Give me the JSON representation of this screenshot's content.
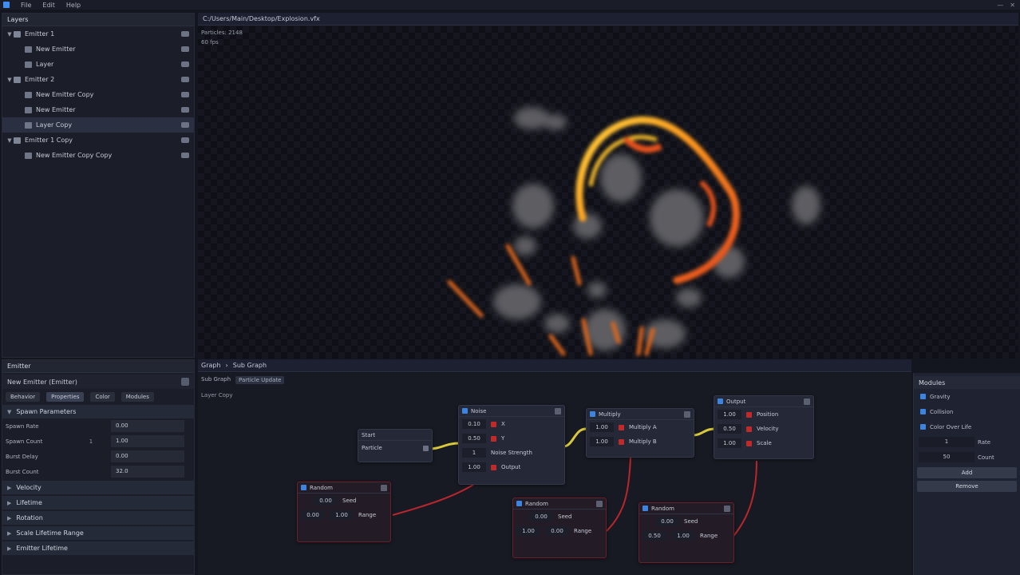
{
  "menu": {
    "items": [
      "File",
      "Edit",
      "Help"
    ]
  },
  "tree": {
    "title": "Layers",
    "rows": [
      {
        "label": "Emitter 1",
        "indent": 0,
        "expanded": true,
        "selected": false
      },
      {
        "label": "New Emitter",
        "indent": 1,
        "expanded": false,
        "selected": false
      },
      {
        "label": "Layer",
        "indent": 1,
        "expanded": false,
        "selected": false
      },
      {
        "label": "Emitter 2",
        "indent": 0,
        "expanded": true,
        "selected": false
      },
      {
        "label": "New Emitter Copy",
        "indent": 1,
        "expanded": false,
        "selected": false
      },
      {
        "label": "New Emitter",
        "indent": 1,
        "expanded": false,
        "selected": false
      },
      {
        "label": "Layer Copy",
        "indent": 1,
        "expanded": false,
        "selected": true
      },
      {
        "label": "Emitter 1 Copy",
        "indent": 0,
        "expanded": true,
        "selected": false
      },
      {
        "label": "New Emitter Copy Copy",
        "indent": 1,
        "expanded": false,
        "selected": false
      }
    ]
  },
  "viewport": {
    "tab": "C:/Users/Main/Desktop/Explosion.vfx",
    "status_line": "Particles: 2148",
    "fps": "60 fps"
  },
  "props": {
    "title": "Emitter",
    "emitter_name": "New Emitter (Emitter)",
    "filters": [
      "Behavior",
      "Properties",
      "Color",
      "Modules"
    ],
    "sections": [
      {
        "label": "Spawn Parameters",
        "expanded": true
      },
      {
        "label": "Velocity",
        "expanded": false
      },
      {
        "label": "Lifetime",
        "expanded": false
      },
      {
        "label": "Rotation",
        "expanded": false
      },
      {
        "label": "Scale Lifetime Range",
        "expanded": false
      },
      {
        "label": "Emitter Lifetime",
        "expanded": false
      }
    ],
    "params": [
      {
        "name": "Spawn Rate",
        "mid": "",
        "value": "0.00"
      },
      {
        "name": "Spawn Count",
        "mid": "1",
        "value": "1.00"
      },
      {
        "name": "Burst Delay",
        "mid": "",
        "value": "0.00"
      },
      {
        "name": "Burst Count",
        "mid": "",
        "value": "32.0"
      }
    ]
  },
  "graph": {
    "tab": "Graph",
    "tab2": "Sub Graph",
    "status_a": "Sub Graph",
    "status_b": "Particle Update",
    "sub": "Layer Copy",
    "nodes": {
      "start": {
        "title": "Start",
        "row": "Particle"
      },
      "noise": {
        "title": "Noise",
        "rows": [
          [
            "0.10",
            "X"
          ],
          [
            "0.50",
            "Y"
          ],
          [
            "1",
            "Noise Strength"
          ],
          [
            "1.00",
            "Output"
          ]
        ]
      },
      "multiply": {
        "title": "Multiply",
        "rows": [
          [
            "1.00",
            "Multiply A"
          ],
          [
            "1.00",
            "Multiply B"
          ]
        ]
      },
      "output": {
        "title": "Output",
        "rows": [
          [
            "1.00",
            "Position"
          ],
          [
            "0.50",
            "Velocity"
          ],
          [
            "1.00",
            "Scale"
          ]
        ]
      },
      "rand1": {
        "title": "Random",
        "top": "0.00",
        "topLabel": "Seed",
        "row": [
          "0.00",
          "1.00",
          "Range"
        ]
      },
      "rand2": {
        "title": "Random",
        "top": "0.00",
        "topLabel": "Seed",
        "row": [
          "1.00",
          "0.00",
          "Range"
        ]
      },
      "rand3": {
        "title": "Random",
        "top": "0.00",
        "topLabel": "Seed",
        "row": [
          "0.50",
          "1.00",
          "Range"
        ]
      }
    }
  },
  "right": {
    "title": "Modules",
    "checks": [
      "Gravity",
      "Collision",
      "Color Over Life"
    ],
    "nums": [
      {
        "v": "1",
        "label": "Rate"
      },
      {
        "v": "50",
        "label": "Count"
      }
    ],
    "buttons": [
      "Add",
      "Remove"
    ]
  },
  "colors": {
    "accent": "#3c84e0",
    "link_red": "#c22a2a",
    "link_yellow": "#d8c83a"
  }
}
